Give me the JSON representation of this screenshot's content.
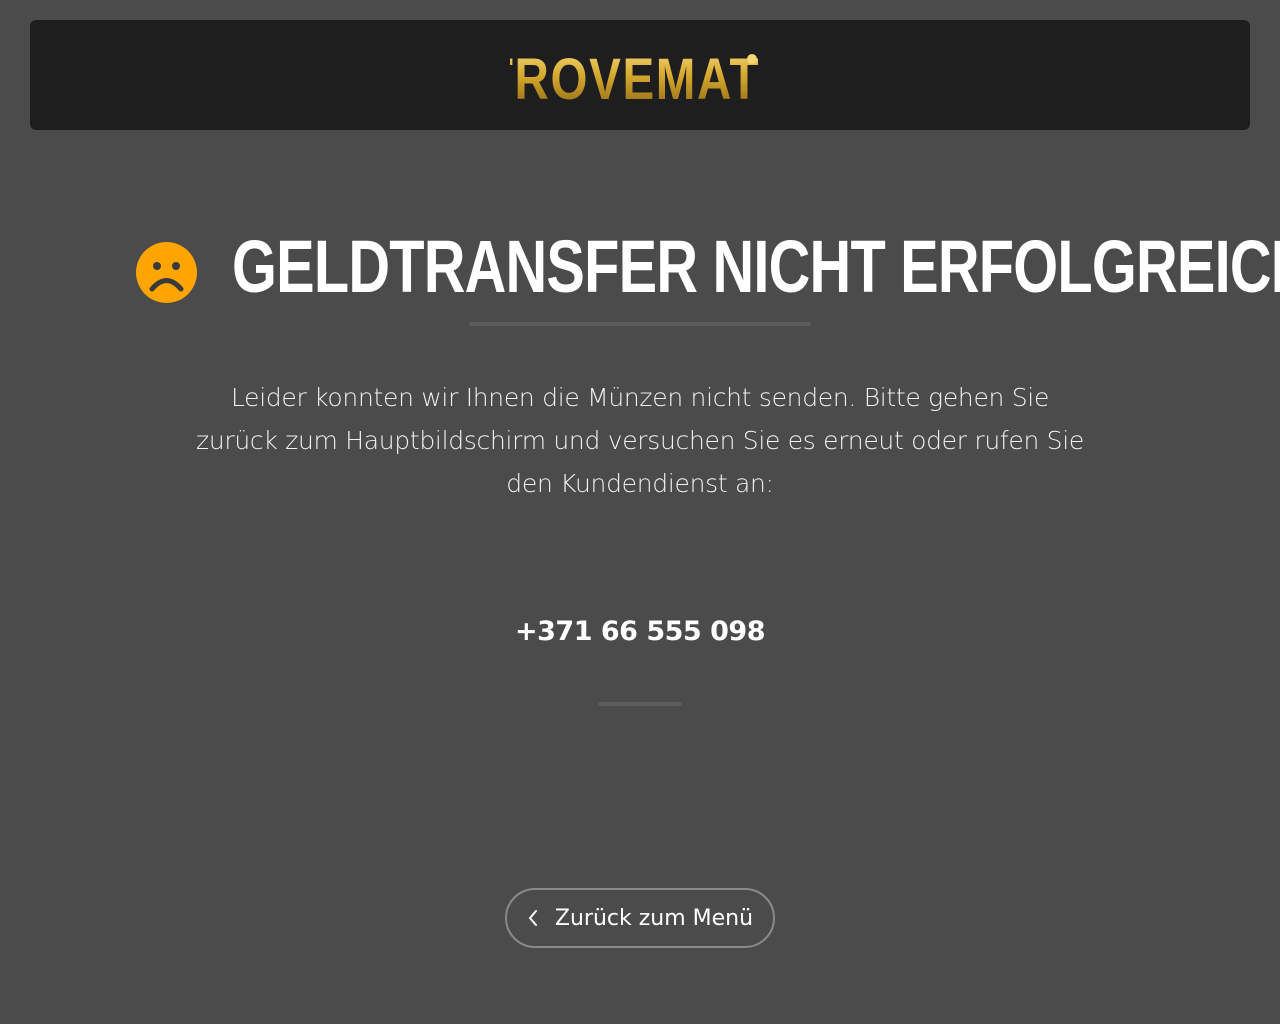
{
  "header": {
    "logo_text": "TROVEMAT",
    "logo_icon": "dot-icon"
  },
  "status": {
    "icon": "sad-face-icon",
    "icon_color": "#FFA500",
    "title": "Geldtransfer nicht erfolgreich",
    "message": "Leider konnten wir Ihnen die Münzen nicht senden. Bitte gehen Sie zurück zum Hauptbildschirm und versuchen Sie es erneut oder rufen Sie den Kundendienst an:",
    "phone": "+371 66 555 098"
  },
  "actions": {
    "back_label": "Zurück zum Menü",
    "back_icon": "chevron-left-icon"
  },
  "colors": {
    "background": "#4b4b4b",
    "header_background": "#1e1e1e",
    "logo_gold": "#d4a72c"
  }
}
